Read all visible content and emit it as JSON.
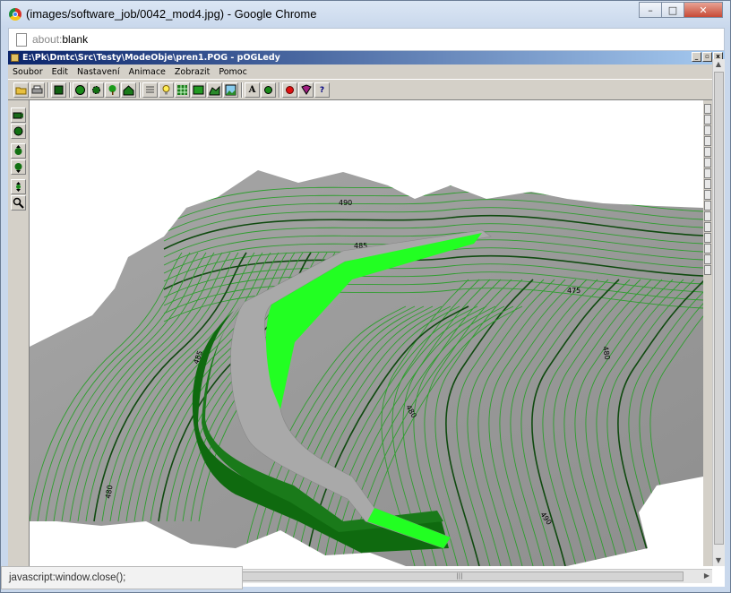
{
  "browser": {
    "title": "(images/software_job/0042_mod4.jpg) - Google Chrome",
    "url_scheme": "about:",
    "url_rest": "blank",
    "status_text": "javascript:window.close();",
    "buttons": {
      "minimize": "–",
      "maximize": "□",
      "close": "✕"
    }
  },
  "app": {
    "title": "E:\\Pk\\Dmtc\\Src\\Testy\\ModeObje\\pren1.POG - pOGLedy",
    "menu": [
      "Soubor",
      "Edit",
      "Nastavení",
      "Animace",
      "Zobrazit",
      "Pomoc"
    ],
    "mdi_buttons": [
      "_",
      "▫",
      "x"
    ],
    "scroll_grip": "|||"
  },
  "map": {
    "contour_labels": [
      "490",
      "485",
      "475",
      "480",
      "480",
      "485",
      "490",
      "480",
      "485"
    ]
  },
  "colors": {
    "terrain": "#9c9c9c",
    "contour": "#2e9e2e",
    "contour_index": "#0f4a0f",
    "road_top": "#a9a9a9",
    "embankment_light": "#22ff22",
    "embankment_dark": "#0f6a0f"
  },
  "icons": {
    "toolbar": [
      "open-icon",
      "print-icon",
      "display-icon",
      "globe-icon",
      "settings-icon",
      "tree-icon",
      "house-icon",
      "list-icon",
      "bulb-icon",
      "grid-icon",
      "table-icon",
      "surface-icon",
      "image-icon",
      "text-icon",
      "circle-icon",
      "record-icon",
      "book-icon",
      "help-icon"
    ],
    "left": [
      "camera-icon",
      "sphere-icon",
      "sphere-up-icon",
      "sphere-down-icon",
      "move-icon",
      "zoom-icon"
    ]
  }
}
